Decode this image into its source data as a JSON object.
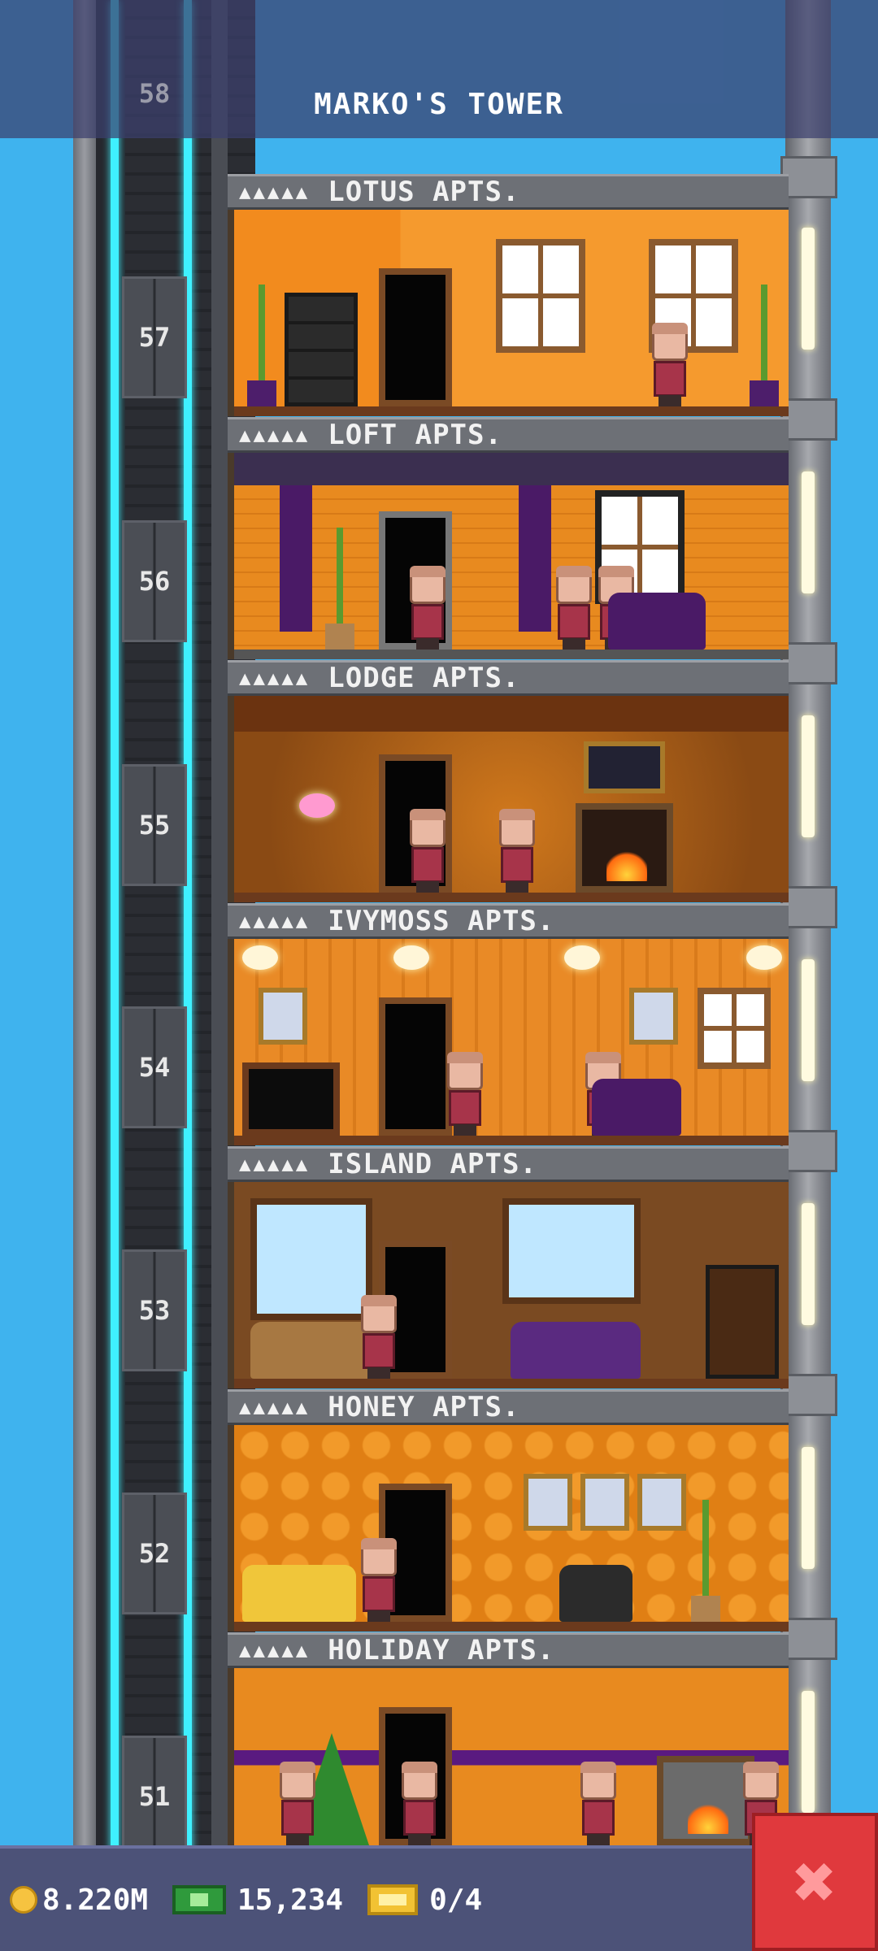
{
  "header": {
    "title": "MARKO'S TOWER",
    "ghost_floor_number": "58"
  },
  "floors": [
    {
      "number": "57",
      "stars": "▲▲▲▲▲",
      "name": "LOTUS APTS."
    },
    {
      "number": "56",
      "stars": "▲▲▲▲▲",
      "name": "LOFT APTS."
    },
    {
      "number": "55",
      "stars": "▲▲▲▲▲",
      "name": "LODGE APTS."
    },
    {
      "number": "54",
      "stars": "▲▲▲▲▲",
      "name": "IVYMOSS APTS."
    },
    {
      "number": "53",
      "stars": "▲▲▲▲▲",
      "name": "ISLAND APTS."
    },
    {
      "number": "52",
      "stars": "▲▲▲▲▲",
      "name": "HONEY APTS."
    },
    {
      "number": "51",
      "stars": "▲▲▲▲▲",
      "name": "HOLIDAY APTS."
    }
  ],
  "status": {
    "coins": "8.220M",
    "bux": "15,234",
    "tickets": "0/4"
  },
  "icons": {
    "coin": "coin-icon",
    "bux": "tower-bux-icon",
    "ticket": "golden-ticket-icon",
    "close": "close-icon"
  },
  "close_label": "✖"
}
